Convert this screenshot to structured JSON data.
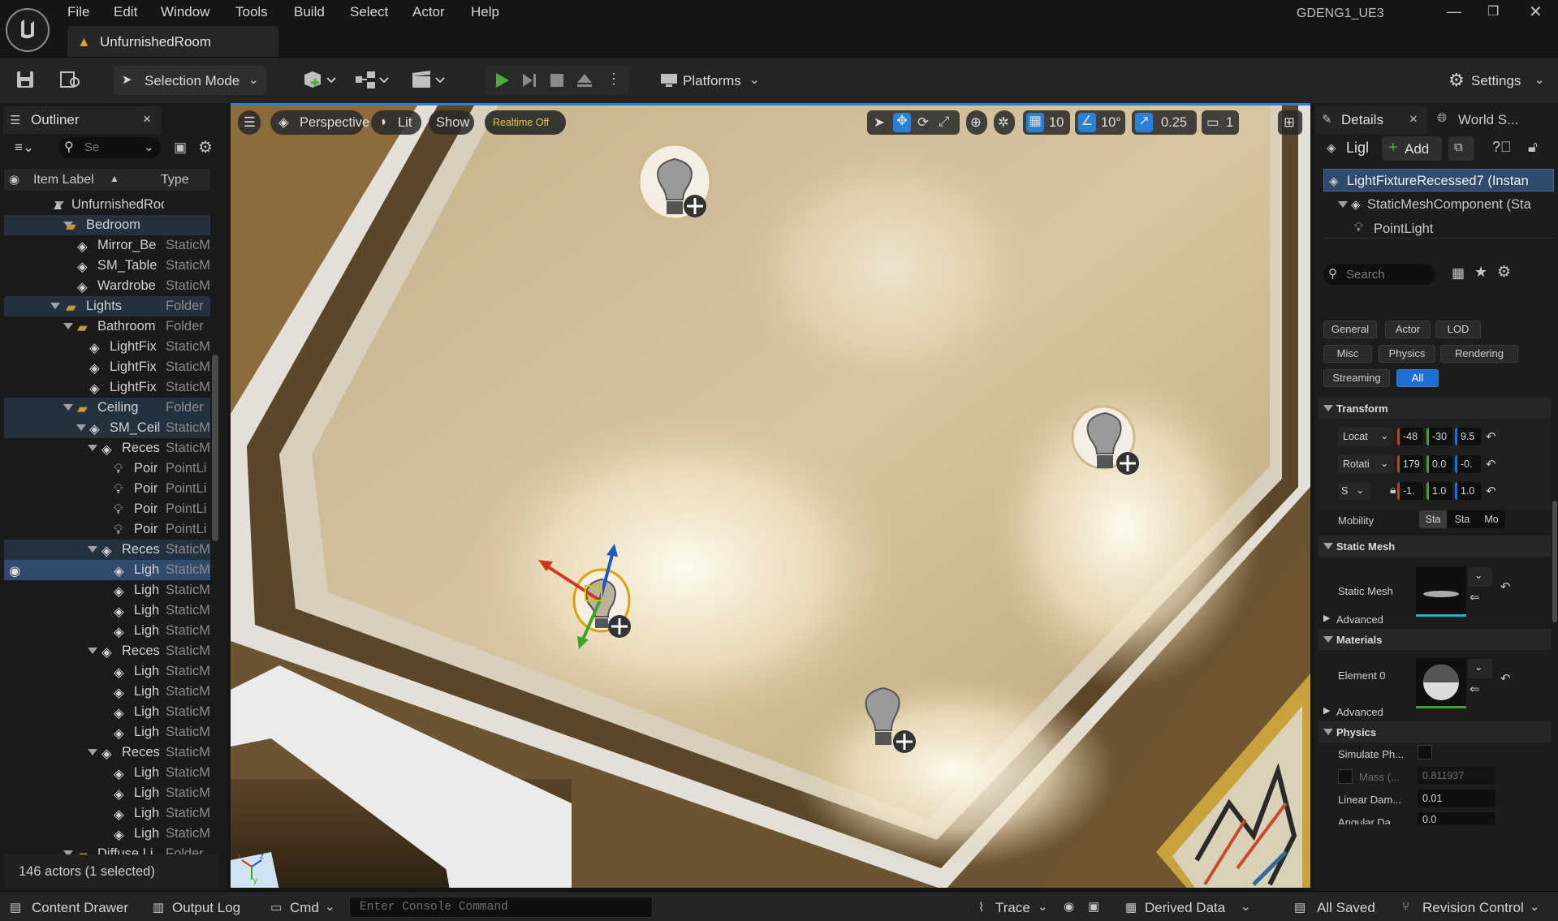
{
  "menu": {
    "items": [
      "File",
      "Edit",
      "Window",
      "Tools",
      "Build",
      "Select",
      "Actor",
      "Help"
    ],
    "project": "GDENG1_UE3"
  },
  "tab": {
    "level_name": "UnfurnishedRoom"
  },
  "toolbar": {
    "mode_label": "Selection Mode",
    "platforms_label": "Platforms",
    "settings_label": "Settings"
  },
  "outliner": {
    "title": "Outliner",
    "search_placeholder": "Se",
    "col_label": "Item Label",
    "col_type": "Type",
    "rows": [
      {
        "label": "UnfurnishedRoom (Ed",
        "type": ""
      },
      {
        "label": "Bedroom",
        "type": ""
      },
      {
        "label": "Mirror_Be",
        "type": "StaticM"
      },
      {
        "label": "SM_Table",
        "type": "StaticM"
      },
      {
        "label": "Wardrobe",
        "type": "StaticM"
      },
      {
        "label": "Lights",
        "type": "Folder"
      },
      {
        "label": "Bathroom",
        "type": "Folder"
      },
      {
        "label": "LightFix",
        "type": "StaticM"
      },
      {
        "label": "LightFix",
        "type": "StaticM"
      },
      {
        "label": "LightFix",
        "type": "StaticM"
      },
      {
        "label": "Ceiling",
        "type": "Folder"
      },
      {
        "label": "SM_Ceil",
        "type": "StaticM"
      },
      {
        "label": "Reces",
        "type": "StaticM"
      },
      {
        "label": "Poir",
        "type": "PointLi"
      },
      {
        "label": "Poir",
        "type": "PointLi"
      },
      {
        "label": "Poir",
        "type": "PointLi"
      },
      {
        "label": "Poir",
        "type": "PointLi"
      },
      {
        "label": "Reces",
        "type": "StaticM"
      },
      {
        "label": "Ligh",
        "type": "StaticM"
      },
      {
        "label": "Ligh",
        "type": "StaticM"
      },
      {
        "label": "Ligh",
        "type": "StaticM"
      },
      {
        "label": "Ligh",
        "type": "StaticM"
      },
      {
        "label": "Reces",
        "type": "StaticM"
      },
      {
        "label": "Ligh",
        "type": "StaticM"
      },
      {
        "label": "Ligh",
        "type": "StaticM"
      },
      {
        "label": "Ligh",
        "type": "StaticM"
      },
      {
        "label": "Ligh",
        "type": "StaticM"
      },
      {
        "label": "Reces",
        "type": "StaticM"
      },
      {
        "label": "Ligh",
        "type": "StaticM"
      },
      {
        "label": "Ligh",
        "type": "StaticM"
      },
      {
        "label": "Ligh",
        "type": "StaticM"
      },
      {
        "label": "Ligh",
        "type": "StaticM"
      },
      {
        "label": "Diffuse Li",
        "type": "Folder"
      }
    ],
    "footer": "146 actors (1 selected)"
  },
  "viewport": {
    "perspective": "Perspective",
    "lit": "Lit",
    "show": "Show",
    "realtime": "Realtime Off",
    "grid_snap": "10",
    "rot_snap": "10°",
    "scale_snap": "0.25",
    "camera_speed": "1"
  },
  "details": {
    "tab_details": "Details",
    "tab_world": "World S...",
    "actor_short": "Ligl",
    "add_label": "Add",
    "components": [
      "LightFixtureRecessed7 (Instan",
      "StaticMeshComponent (Sta",
      "PointLight"
    ],
    "search_placeholder": "Search",
    "categories": [
      "General",
      "Actor",
      "LOD",
      "Misc",
      "Physics",
      "Rendering",
      "Streaming",
      "All"
    ],
    "transform": {
      "title": "Transform",
      "location_label": "Locat",
      "rotation_label": "Rotati",
      "scale_label": "S",
      "location": [
        "-48",
        "-30",
        "9.5"
      ],
      "rotation": [
        "179",
        "0.0",
        "-0."
      ],
      "scale": [
        "-1.",
        "1.0",
        "1.0"
      ],
      "mobility_label": "Mobility",
      "mobility": [
        "Sta",
        "Sta",
        "Mo"
      ]
    },
    "static_mesh": {
      "title": "Static Mesh",
      "label": "Static Mesh",
      "advanced": "Advanced"
    },
    "materials": {
      "title": "Materials",
      "element": "Element 0",
      "advanced": "Advanced"
    },
    "physics": {
      "title": "Physics",
      "simulate": "Simulate Ph...",
      "mass": "Mass (...",
      "mass_value": "0.811937",
      "linear_damping": "Linear Dam...",
      "linear_value": "0.01",
      "angular_damping": "Angular Da...",
      "angular_value": "0.0"
    }
  },
  "statusbar": {
    "content_drawer": "Content Drawer",
    "output_log": "Output Log",
    "cmd": "Cmd",
    "console_placeholder": "Enter Console Command",
    "trace": "Trace",
    "derived_data": "Derived Data",
    "all_saved": "All Saved",
    "revision_control": "Revision Control"
  },
  "colors": {
    "accent": "#2a7fd6",
    "selection": "#2f4a6c",
    "play": "#4caf3a"
  }
}
